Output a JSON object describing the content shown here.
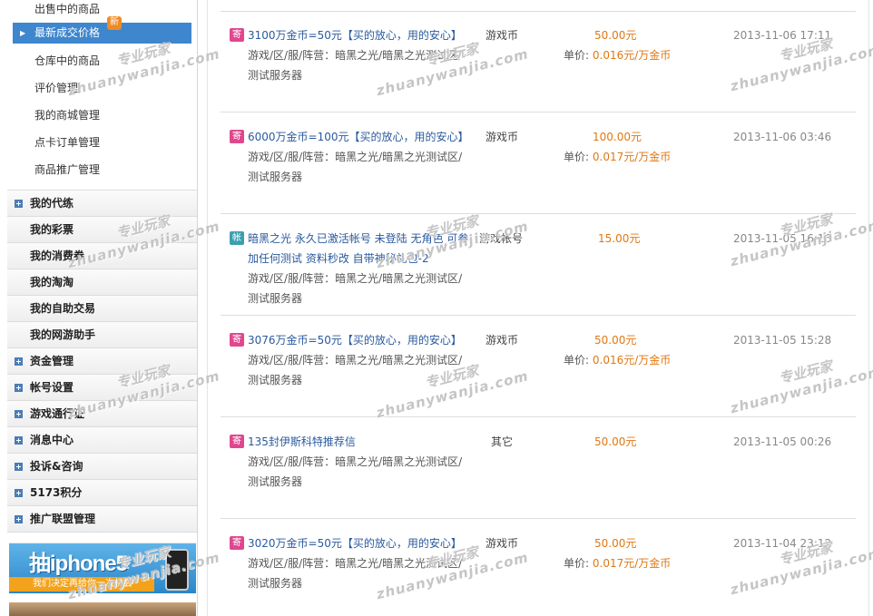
{
  "sidebar": {
    "sub_items": [
      "出售中的商品",
      "最新成交价格",
      "仓库中的商品",
      "评价管理",
      "我的商城管理",
      "点卡订单管理",
      "商品推广管理"
    ],
    "new_badge": "新",
    "sections": [
      {
        "label": "我的代练",
        "plus": true
      },
      {
        "label": "我的彩票",
        "plus": false
      },
      {
        "label": "我的消费券",
        "plus": false
      },
      {
        "label": "我的淘淘",
        "plus": false
      },
      {
        "label": "我的自助交易",
        "plus": false
      },
      {
        "label": "我的网游助手",
        "plus": false
      },
      {
        "label": "资金管理",
        "plus": true
      },
      {
        "label": "帐号设置",
        "plus": true
      },
      {
        "label": "游戏通行证",
        "plus": true
      },
      {
        "label": "消息中心",
        "plus": true
      },
      {
        "label": "投诉&咨询",
        "plus": true
      },
      {
        "label": "5173积分",
        "plus": true
      },
      {
        "label": "推广联盟管理",
        "plus": true
      }
    ],
    "banner": {
      "title": "抽iphone5",
      "subtitle": "我们决定再给你一次机会"
    }
  },
  "orders": [
    {
      "badge": "寄",
      "badge_type": "ji",
      "title": "3100万金币=50元【买的放心，用的安心】",
      "meta": "游戏/区/服/阵营：暗黑之光/暗黑之光测试区/测试服务器",
      "type": "游戏币",
      "price": "50.00元",
      "unit_label": "单价:",
      "unit_value": "0.016元/万金币",
      "date": "2013-11-06 17:11"
    },
    {
      "badge": "寄",
      "badge_type": "ji",
      "title": "6000万金币=100元【买的放心，用的安心】",
      "meta": "游戏/区/服/阵营：暗黑之光/暗黑之光测试区/测试服务器",
      "type": "游戏币",
      "price": "100.00元",
      "unit_label": "单价:",
      "unit_value": "0.017元/万金币",
      "date": "2013-11-06 03:46"
    },
    {
      "badge": "帐",
      "badge_type": "jian",
      "title": "暗黑之光 永久已激活帐号 未登陆 无角色 可参加任何测试 资料秒改 自带神秘礼包-2",
      "meta": "游戏/区/服/阵营：暗黑之光/暗黑之光测试区/测试服务器",
      "type": "游戏帐号",
      "price": "15.00元",
      "unit_label": "",
      "unit_value": "",
      "date": "2013-11-05 16:16"
    },
    {
      "badge": "寄",
      "badge_type": "ji",
      "title": "3076万金币=50元【买的放心，用的安心】",
      "meta": "游戏/区/服/阵营：暗黑之光/暗黑之光测试区/测试服务器",
      "type": "游戏币",
      "price": "50.00元",
      "unit_label": "单价:",
      "unit_value": "0.016元/万金币",
      "date": "2013-11-05 15:28"
    },
    {
      "badge": "寄",
      "badge_type": "ji",
      "title": "135封伊斯科特推荐信",
      "meta": "游戏/区/服/阵营：暗黑之光/暗黑之光测试区/测试服务器",
      "type": "其它",
      "price": "50.00元",
      "unit_label": "",
      "unit_value": "",
      "date": "2013-11-05 00:26"
    },
    {
      "badge": "寄",
      "badge_type": "ji",
      "title": "3020万金币=50元【买的放心，用的安心】",
      "meta": "游戏/区/服/阵营：暗黑之光/暗黑之光测试区/测试服务器",
      "type": "游戏币",
      "price": "50.00元",
      "unit_label": "单价:",
      "unit_value": "0.017元/万金币",
      "date": "2013-11-04 23:12"
    }
  ],
  "watermark": {
    "line1": "专业玩家",
    "line2": "zhuanywanjia.com"
  }
}
